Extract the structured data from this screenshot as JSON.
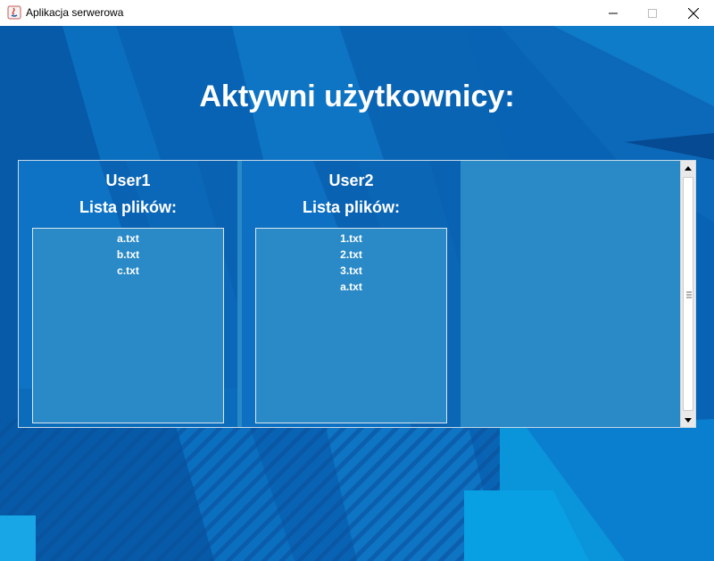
{
  "window": {
    "title": "Aplikacja serwerowa",
    "icon": "java-icon",
    "controls": [
      "minimize-icon",
      "maximize-icon",
      "close-icon"
    ]
  },
  "heading": "Aktywni użytkownicy:",
  "users": [
    {
      "name": "User1",
      "files_label": "Lista plików:",
      "files": [
        "a.txt",
        "b.txt",
        "c.txt"
      ]
    },
    {
      "name": "User2",
      "files_label": "Lista plików:",
      "files": [
        "1.txt",
        "2.txt",
        "3.txt",
        "a.txt"
      ]
    }
  ],
  "colors": {
    "background_blue": "#0a5fae",
    "panel_blue": "#2a8ac8",
    "text": "#ffffff"
  }
}
